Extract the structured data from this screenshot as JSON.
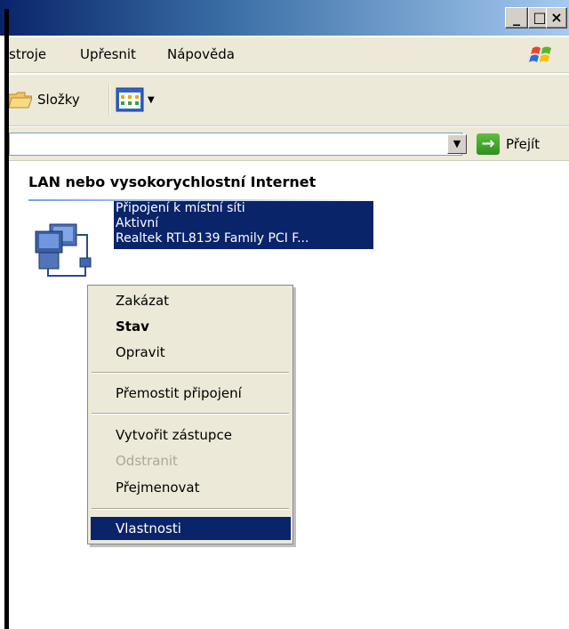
{
  "menubar": {
    "items": [
      "stroje",
      "Upřesnit",
      "Nápověda"
    ]
  },
  "toolbar": {
    "folders_label": "Složky"
  },
  "addressbar": {
    "go_label": "Přejít"
  },
  "content": {
    "group_heading": "LAN nebo vysokorychlostní Internet",
    "connection": {
      "name": "Připojení k místní síti",
      "status": "Aktivní",
      "device": "Realtek RTL8139 Family PCI F..."
    }
  },
  "context_menu": {
    "items": [
      {
        "label": "Zakázat"
      },
      {
        "label": "Stav"
      },
      {
        "label": "Opravit"
      },
      {
        "label": "Přemostit připojení"
      },
      {
        "label": "Vytvořit zástupce"
      },
      {
        "label": "Odstranit"
      },
      {
        "label": "Přejmenovat"
      },
      {
        "label": "Vlastnosti"
      }
    ]
  },
  "colors": {
    "selection": "#0a246a",
    "menu_bg": "#ece9d8",
    "disabled_text": "#aca899"
  }
}
